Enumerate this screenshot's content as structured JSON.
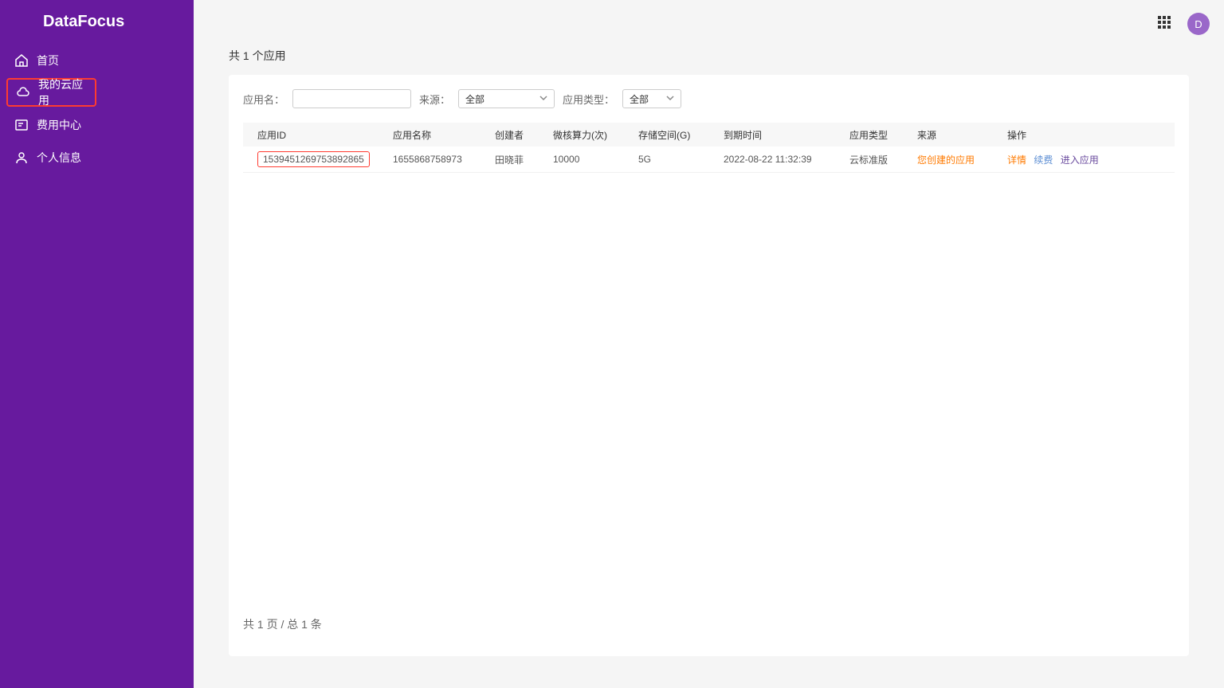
{
  "brand": "DataFocus",
  "sidebar": {
    "items": [
      {
        "label": "首页"
      },
      {
        "label": "我的云应用"
      },
      {
        "label": "费用中心"
      },
      {
        "label": "个人信息"
      }
    ]
  },
  "avatar_letter": "D",
  "content": {
    "count_text": "共 1 个应用",
    "footer_text": "共 1 页 / 总 1 条"
  },
  "filters": {
    "app_name_label": "应用名：",
    "app_name_value": "",
    "source_label": "来源：",
    "source_value": "全部",
    "type_label": "应用类型：",
    "type_value": "全部"
  },
  "table": {
    "headers": [
      "应用ID",
      "应用名称",
      "创建者",
      "微核算力(次)",
      "存储空间(G)",
      "到期时间",
      "应用类型",
      "来源",
      "操作"
    ],
    "rows": [
      {
        "id": "1539451269753892865",
        "name": "1655868758973",
        "creator": "田晓菲",
        "compute": "10000",
        "storage": "5G",
        "expiry": "2022-08-22 11:32:39",
        "app_type": "云标准版",
        "source": "您创建的应用",
        "actions": {
          "detail": "详情",
          "renew": "续费",
          "enter": "进入应用"
        }
      }
    ]
  }
}
